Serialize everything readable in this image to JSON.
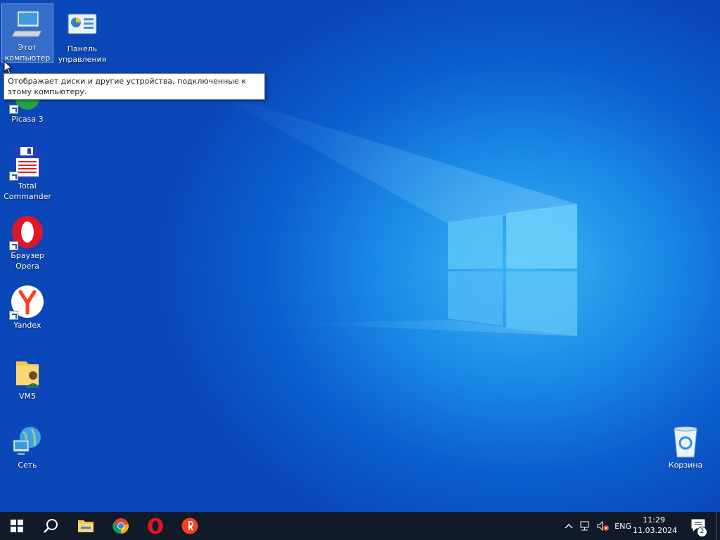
{
  "desktop": {
    "icons": [
      {
        "label": "Этот компьютер",
        "icon": "computer-icon"
      },
      {
        "label": "Панель управления",
        "icon": "control-panel-icon"
      },
      {
        "label": "Picasa 3",
        "icon": "picasa-icon"
      },
      {
        "label": "Total Commander",
        "icon": "total-commander-icon"
      },
      {
        "label": "Браузер Opera",
        "icon": "opera-icon"
      },
      {
        "label": "Yandex",
        "icon": "yandex-icon"
      },
      {
        "label": "VM5",
        "icon": "user-folder-icon"
      },
      {
        "label": "Сеть",
        "icon": "network-icon"
      },
      {
        "label": "Корзина",
        "icon": "recycle-bin-icon"
      }
    ],
    "tooltip": "Отображает диски и другие устройства, подключенные к этому компьютеру."
  },
  "taskbar": {
    "pinned": [
      "start-icon",
      "search-icon",
      "file-explorer-icon",
      "chrome-icon",
      "opera-icon",
      "yandex-browser-icon"
    ],
    "tray": {
      "language": "ENG",
      "time": "11:29",
      "date": "11.03.2024",
      "notification_count": "2"
    }
  },
  "colors": {
    "taskbar": "#101a28",
    "desktop_accent": "#1a8ae6",
    "opera_red": "#e0142b",
    "yandex_red": "#fc3f1d"
  }
}
